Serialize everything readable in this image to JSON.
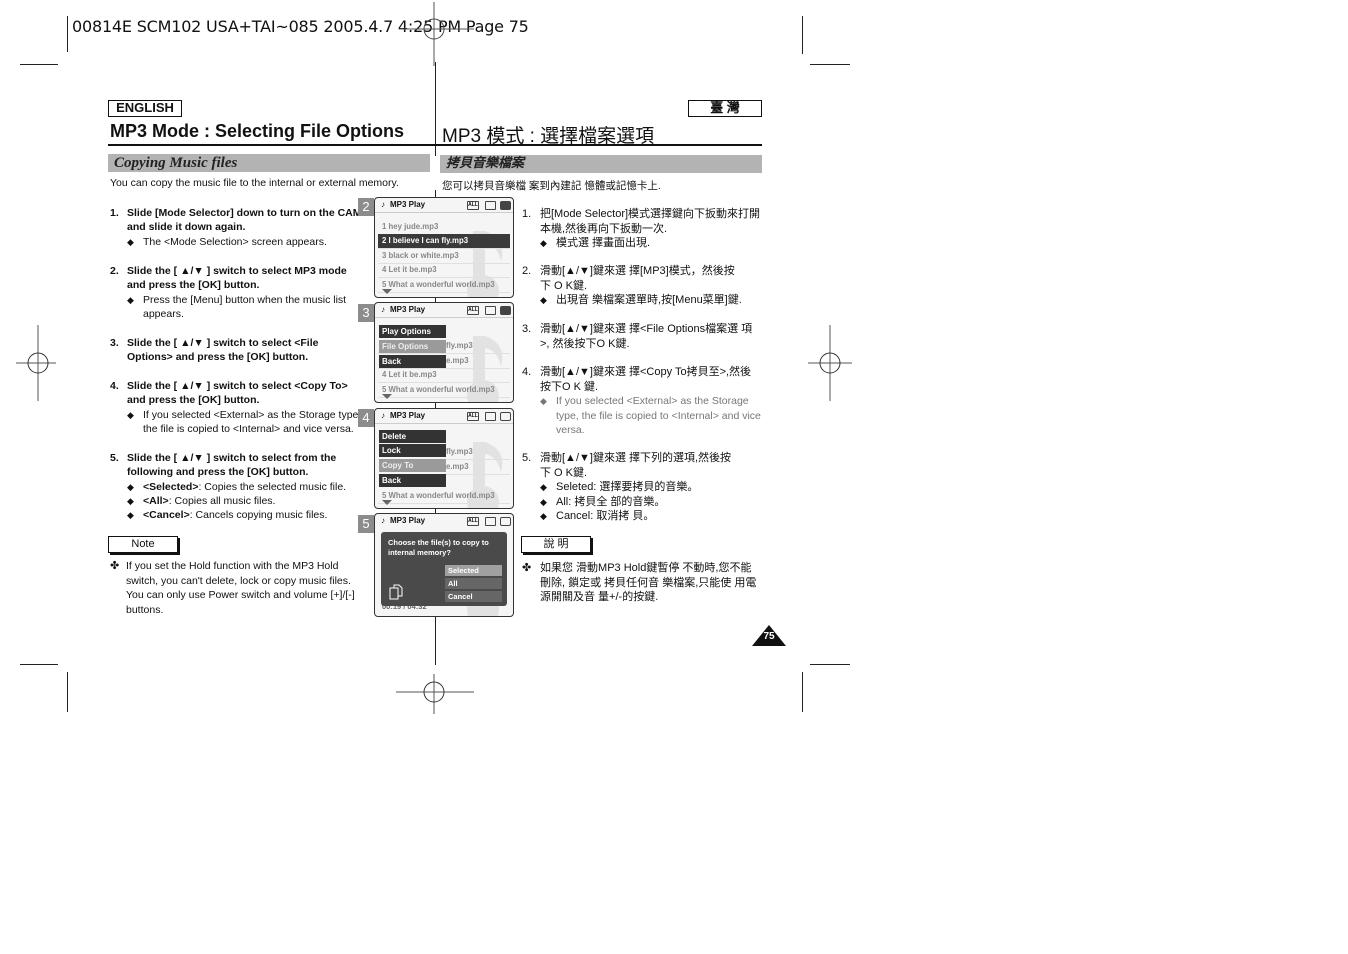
{
  "slug": "00814E SCM102  USA+TAI~085  2005.4.7  4:25 PM  Page 75",
  "english": {
    "lang_label": "ENGLISH",
    "title": "MP3 Mode : Selecting File Options",
    "section": "Copying Music files",
    "intro": "You can copy the music file to the internal or external memory.",
    "steps": [
      {
        "num": "1.",
        "head": "Slide [Mode Selector] down to turn on the CAM and slide it down again.",
        "bullets": [
          "The <Mode Selection> screen appears."
        ]
      },
      {
        "num": "2.",
        "head": "Slide the [ ▲/▼ ] switch to select MP3 mode and press the [OK] button.",
        "bullets": [
          "Press the [Menu] button when the music list appears."
        ]
      },
      {
        "num": "3.",
        "head": "Slide the [ ▲/▼ ] switch to select <File Options> and press the [OK] button.",
        "bullets": []
      },
      {
        "num": "4.",
        "head": "Slide the [ ▲/▼ ] switch to select <Copy To> and press the [OK] button.",
        "bullets": [
          "If you selected <External> as the Storage type, the file is copied to <Internal> and vice versa."
        ]
      },
      {
        "num": "5.",
        "head": "Slide the [ ▲/▼ ] switch to select from the following and press the [OK] button.",
        "bullets": []
      }
    ],
    "step5_options": [
      {
        "term": "<Selected>",
        "desc": ": Copies the selected music file."
      },
      {
        "term": "<All>",
        "desc": ": Copies all music files."
      },
      {
        "term": "<Cancel>",
        "desc": ": Cancels copying music files."
      }
    ],
    "note_label": "Note",
    "note_text": "If you set the Hold function with the MP3 Hold switch, you can't delete, lock or copy music files. You can only use Power switch and volume [+]/[-] buttons."
  },
  "chinese": {
    "lang_label": "臺 灣",
    "title": "MP3 模式 : 選擇檔案選項",
    "section": "拷貝音樂檔案",
    "intro": "您可以拷貝音樂檔 案到內建記 憶體或記憶卡上.",
    "steps": [
      {
        "num": "1.",
        "text": "把[Mode Selector]模式選擇鍵向下扳動來打開本機,然後再向下扳動一次.",
        "bullets": [
          "模式選 擇畫面出現."
        ]
      },
      {
        "num": "2.",
        "text": "滑動[▲/▼]鍵來選 擇[MP3]模式，然後按下 O K鍵.",
        "bullets": [
          "出現音 樂檔案選單時,按[Menu菜單]鍵."
        ]
      },
      {
        "num": "3.",
        "text": "滑動[▲/▼]鍵來選 擇<File Options檔案選 項>, 然後按下O K鍵.",
        "bullets": []
      },
      {
        "num": "4.",
        "text": "滑動[▲/▼]鍵來選 擇<Copy To拷貝至>,然後按下O K 鍵.",
        "bullets_gray": [
          "If you selected <External> as the Storage type, the file is copied to <Internal> and vice versa."
        ]
      },
      {
        "num": "5.",
        "text": "滑動[▲/▼]鍵來選 擇下列的選項,然後按下 O K鍵.",
        "bullets": [
          "Seleted: 選擇要拷貝的音樂。",
          "All: 拷貝全 部的音樂。",
          "Cancel: 取消拷 貝。"
        ]
      }
    ],
    "note_label": "說 明",
    "note_text": "如果您 滑動MP3 Hold鍵暫停 不動時,您不能 刪除, 鎖定或 拷貝任何音 樂檔案,只能使 用電源開關及音 量+/-的按鍵."
  },
  "screens": [
    {
      "num": "2",
      "header": "MP3 Play",
      "rows": [
        {
          "text": "1  hey jude.mp3",
          "selected": false
        },
        {
          "text": "2  I believe I can fly.mp3",
          "selected": true
        },
        {
          "text": "3  black or white.mp3",
          "selected": false
        },
        {
          "text": "4  Let it be.mp3",
          "selected": false
        },
        {
          "text": "5  What a wonderful world.mp3",
          "selected": false
        }
      ]
    },
    {
      "num": "3",
      "header": "MP3 Play",
      "rows": [
        {
          "text": "",
          "selected": false
        },
        {
          "text": "fly.mp3",
          "selected": false
        },
        {
          "text": "e.mp3",
          "selected": false
        },
        {
          "text": "4  Let it be.mp3",
          "selected": false
        },
        {
          "text": "5  What a wonderful world.mp3",
          "selected": false
        }
      ],
      "menu": [
        {
          "label": "Play Options",
          "highlight": false
        },
        {
          "label": "File Options",
          "highlight": true
        },
        {
          "label": "Back",
          "highlight": false
        }
      ]
    },
    {
      "num": "4",
      "header": "MP3 Play",
      "rows": [
        {
          "text": "",
          "selected": false
        },
        {
          "text": "fly.mp3",
          "selected": false
        },
        {
          "text": "e.mp3",
          "selected": false
        },
        {
          "text": "",
          "selected": false
        },
        {
          "text": "5  What a wonderful world.mp3",
          "selected": false
        }
      ],
      "menu": [
        {
          "label": "Delete",
          "highlight": false
        },
        {
          "label": "Lock",
          "highlight": false
        },
        {
          "label": "Copy To",
          "highlight": true
        },
        {
          "label": "Back",
          "highlight": false
        }
      ]
    },
    {
      "num": "5",
      "header": "MP3 Play",
      "dialog": {
        "question": "Choose the file(s) to copy to internal memory?",
        "options": [
          {
            "label": "Selected",
            "highlight": true
          },
          {
            "label": "All",
            "highlight": false
          },
          {
            "label": "Cancel",
            "highlight": false
          }
        ]
      },
      "footer_time": "00:19 / 04:32"
    }
  ],
  "header_icons": {
    "all": "ALL",
    "card": "card-icon",
    "battery": "battery-icon"
  },
  "page_number": "75"
}
